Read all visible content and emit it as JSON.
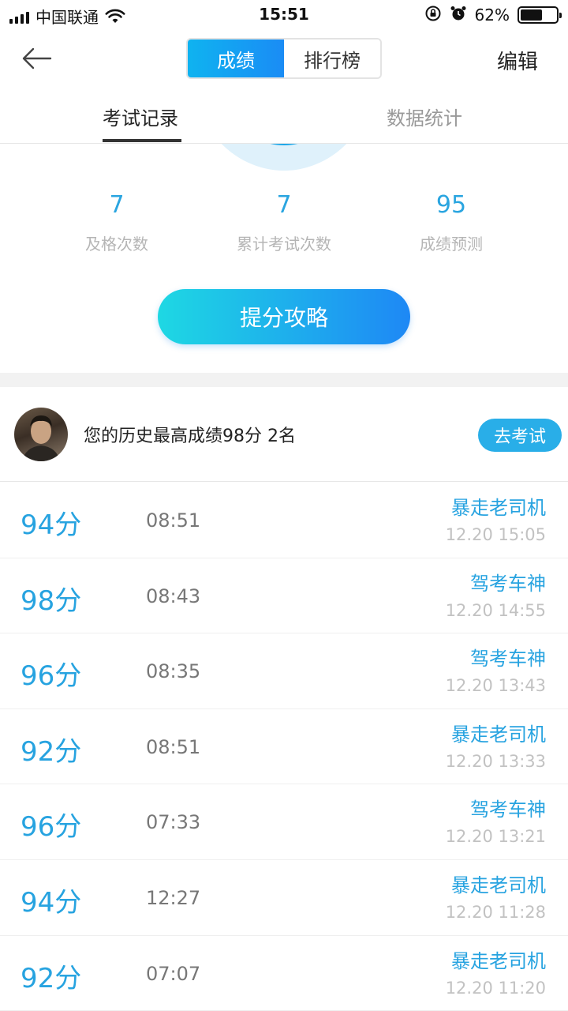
{
  "status_bar": {
    "carrier": "中国联通",
    "time": "15:51",
    "battery_percent": "62%",
    "battery_level": 0.62
  },
  "nav": {
    "segments": [
      "成绩",
      "排行榜"
    ],
    "active_segment": 0,
    "edit_label": "编辑"
  },
  "tabs": {
    "items": [
      "考试记录",
      "数据统计"
    ],
    "active": 0
  },
  "summary": {
    "stats": [
      {
        "value": "7",
        "label": "及格次数"
      },
      {
        "value": "7",
        "label": "累计考试次数"
      },
      {
        "value": "95",
        "label": "成绩预测"
      }
    ],
    "tips_button": "提分攻略"
  },
  "best": {
    "text": "您的历史最高成绩98分 2名",
    "go_exam_button": "去考试"
  },
  "records": [
    {
      "score": "94分",
      "duration": "08:51",
      "title": "暴走老司机",
      "time": "12.20 15:05"
    },
    {
      "score": "98分",
      "duration": "08:43",
      "title": "驾考车神",
      "time": "12.20 14:55"
    },
    {
      "score": "96分",
      "duration": "08:35",
      "title": "驾考车神",
      "time": "12.20 13:43"
    },
    {
      "score": "92分",
      "duration": "08:51",
      "title": "暴走老司机",
      "time": "12.20 13:33"
    },
    {
      "score": "96分",
      "duration": "07:33",
      "title": "驾考车神",
      "time": "12.20 13:21"
    },
    {
      "score": "94分",
      "duration": "12:27",
      "title": "暴走老司机",
      "time": "12.20 11:28"
    },
    {
      "score": "92分",
      "duration": "07:07",
      "title": "暴走老司机",
      "time": "12.20 11:20"
    }
  ],
  "colors": {
    "accent": "#27a3e0",
    "button_gradient_start": "#1ed8e3",
    "button_gradient_end": "#1e88f5"
  }
}
